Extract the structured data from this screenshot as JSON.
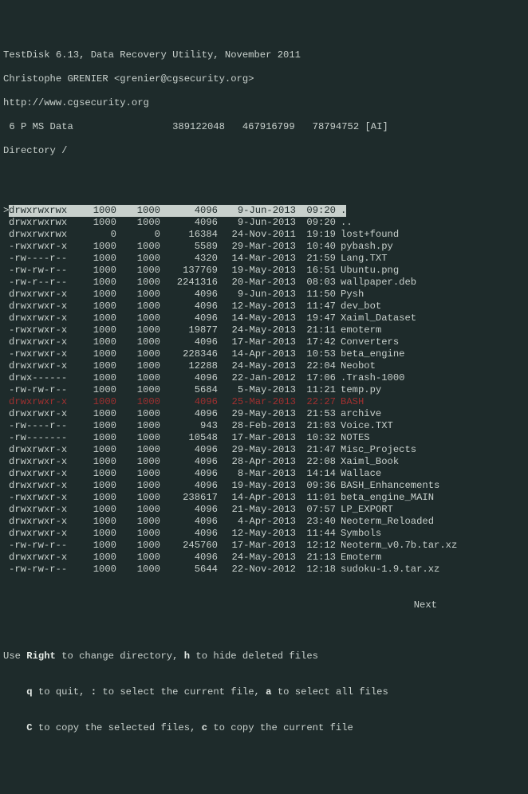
{
  "header": {
    "l1": "TestDisk 6.13, Data Recovery Utility, November 2011",
    "l2": "Christophe GRENIER <grenier@cgsecurity.org>",
    "l3": "http://www.cgsecurity.org",
    "part": " 6 P MS Data                 389122048   467916799   78794752 [AI]",
    "dir": "Directory /"
  },
  "entries": [
    {
      "sel": true,
      "red": false,
      "perms": "drwxrwxrwx",
      "uid": "1000",
      "gid": "1000",
      "size": "4096",
      "date": "9-Jun-2013",
      "time": "09:20",
      "name": "."
    },
    {
      "sel": false,
      "red": false,
      "perms": "drwxrwxrwx",
      "uid": "1000",
      "gid": "1000",
      "size": "4096",
      "date": "9-Jun-2013",
      "time": "09:20",
      "name": ".."
    },
    {
      "sel": false,
      "red": false,
      "perms": "drwxrwxrwx",
      "uid": "0",
      "gid": "0",
      "size": "16384",
      "date": "24-Nov-2011",
      "time": "19:19",
      "name": "lost+found"
    },
    {
      "sel": false,
      "red": false,
      "perms": "-rwxrwxr-x",
      "uid": "1000",
      "gid": "1000",
      "size": "5589",
      "date": "29-Mar-2013",
      "time": "10:40",
      "name": "pybash.py"
    },
    {
      "sel": false,
      "red": false,
      "perms": "-rw----r--",
      "uid": "1000",
      "gid": "1000",
      "size": "4320",
      "date": "14-Mar-2013",
      "time": "21:59",
      "name": "Lang.TXT"
    },
    {
      "sel": false,
      "red": false,
      "perms": "-rw-rw-r--",
      "uid": "1000",
      "gid": "1000",
      "size": "137769",
      "date": "19-May-2013",
      "time": "16:51",
      "name": "Ubuntu.png"
    },
    {
      "sel": false,
      "red": false,
      "perms": "-rw-r--r--",
      "uid": "1000",
      "gid": "1000",
      "size": "2241316",
      "date": "20-Mar-2013",
      "time": "08:03",
      "name": "wallpaper.deb"
    },
    {
      "sel": false,
      "red": false,
      "perms": "drwxrwxr-x",
      "uid": "1000",
      "gid": "1000",
      "size": "4096",
      "date": "9-Jun-2013",
      "time": "11:50",
      "name": "Pysh"
    },
    {
      "sel": false,
      "red": false,
      "perms": "drwxrwxr-x",
      "uid": "1000",
      "gid": "1000",
      "size": "4096",
      "date": "12-May-2013",
      "time": "11:47",
      "name": "dev_bot"
    },
    {
      "sel": false,
      "red": false,
      "perms": "drwxrwxr-x",
      "uid": "1000",
      "gid": "1000",
      "size": "4096",
      "date": "14-May-2013",
      "time": "19:47",
      "name": "Xaiml_Dataset"
    },
    {
      "sel": false,
      "red": false,
      "perms": "-rwxrwxr-x",
      "uid": "1000",
      "gid": "1000",
      "size": "19877",
      "date": "24-May-2013",
      "time": "21:11",
      "name": "emoterm"
    },
    {
      "sel": false,
      "red": false,
      "perms": "drwxrwxr-x",
      "uid": "1000",
      "gid": "1000",
      "size": "4096",
      "date": "17-Mar-2013",
      "time": "17:42",
      "name": "Converters"
    },
    {
      "sel": false,
      "red": false,
      "perms": "-rwxrwxr-x",
      "uid": "1000",
      "gid": "1000",
      "size": "228346",
      "date": "14-Apr-2013",
      "time": "10:53",
      "name": "beta_engine"
    },
    {
      "sel": false,
      "red": false,
      "perms": "drwxrwxr-x",
      "uid": "1000",
      "gid": "1000",
      "size": "12288",
      "date": "24-May-2013",
      "time": "22:04",
      "name": "Neobot"
    },
    {
      "sel": false,
      "red": false,
      "perms": "drwx------",
      "uid": "1000",
      "gid": "1000",
      "size": "4096",
      "date": "22-Jan-2012",
      "time": "17:06",
      "name": ".Trash-1000"
    },
    {
      "sel": false,
      "red": false,
      "perms": "-rw-rw-r--",
      "uid": "1000",
      "gid": "1000",
      "size": "5684",
      "date": "5-May-2013",
      "time": "11:21",
      "name": "temp.py"
    },
    {
      "sel": false,
      "red": true,
      "perms": "drwxrwxr-x",
      "uid": "1000",
      "gid": "1000",
      "size": "4096",
      "date": "25-Mar-2013",
      "time": "22:27",
      "name": "BASH"
    },
    {
      "sel": false,
      "red": false,
      "perms": "drwxrwxr-x",
      "uid": "1000",
      "gid": "1000",
      "size": "4096",
      "date": "29-May-2013",
      "time": "21:53",
      "name": "archive"
    },
    {
      "sel": false,
      "red": false,
      "perms": "-rw----r--",
      "uid": "1000",
      "gid": "1000",
      "size": "943",
      "date": "28-Feb-2013",
      "time": "21:03",
      "name": "Voice.TXT"
    },
    {
      "sel": false,
      "red": false,
      "perms": "-rw-------",
      "uid": "1000",
      "gid": "1000",
      "size": "10548",
      "date": "17-Mar-2013",
      "time": "10:32",
      "name": "NOTES"
    },
    {
      "sel": false,
      "red": false,
      "perms": "drwxrwxr-x",
      "uid": "1000",
      "gid": "1000",
      "size": "4096",
      "date": "29-May-2013",
      "time": "21:47",
      "name": "Misc_Projects"
    },
    {
      "sel": false,
      "red": false,
      "perms": "drwxrwxr-x",
      "uid": "1000",
      "gid": "1000",
      "size": "4096",
      "date": "28-Apr-2013",
      "time": "22:08",
      "name": "Xaiml_Book"
    },
    {
      "sel": false,
      "red": false,
      "perms": "drwxrwxr-x",
      "uid": "1000",
      "gid": "1000",
      "size": "4096",
      "date": "8-Mar-2013",
      "time": "14:14",
      "name": "Wallace"
    },
    {
      "sel": false,
      "red": false,
      "perms": "drwxrwxr-x",
      "uid": "1000",
      "gid": "1000",
      "size": "4096",
      "date": "19-May-2013",
      "time": "09:36",
      "name": "BASH_Enhancements"
    },
    {
      "sel": false,
      "red": false,
      "perms": "-rwxrwxr-x",
      "uid": "1000",
      "gid": "1000",
      "size": "238617",
      "date": "14-Apr-2013",
      "time": "11:01",
      "name": "beta_engine_MAIN"
    },
    {
      "sel": false,
      "red": false,
      "perms": "drwxrwxr-x",
      "uid": "1000",
      "gid": "1000",
      "size": "4096",
      "date": "21-May-2013",
      "time": "07:57",
      "name": "LP_EXPORT"
    },
    {
      "sel": false,
      "red": false,
      "perms": "drwxrwxr-x",
      "uid": "1000",
      "gid": "1000",
      "size": "4096",
      "date": "4-Apr-2013",
      "time": "23:40",
      "name": "Neoterm_Reloaded"
    },
    {
      "sel": false,
      "red": false,
      "perms": "drwxrwxr-x",
      "uid": "1000",
      "gid": "1000",
      "size": "4096",
      "date": "12-May-2013",
      "time": "11:44",
      "name": "Symbols"
    },
    {
      "sel": false,
      "red": false,
      "perms": "-rw-rw-r--",
      "uid": "1000",
      "gid": "1000",
      "size": "245760",
      "date": "17-Mar-2013",
      "time": "12:12",
      "name": "Neoterm_v0.7b.tar.xz"
    },
    {
      "sel": false,
      "red": false,
      "perms": "drwxrwxr-x",
      "uid": "1000",
      "gid": "1000",
      "size": "4096",
      "date": "24-May-2013",
      "time": "21:13",
      "name": "Emoterm"
    },
    {
      "sel": false,
      "red": false,
      "perms": "-rw-rw-r--",
      "uid": "1000",
      "gid": "1000",
      "size": "5644",
      "date": "22-Nov-2012",
      "time": "12:18",
      "name": "sudoku-1.9.tar.xz"
    }
  ],
  "next": "Next",
  "help": {
    "l1_pre": "Use ",
    "k_right": "Right",
    "l1_mid": " to change directory, ",
    "k_h": "h",
    "l1_end": " to hide deleted files",
    "l2_pre": "    ",
    "k_q": "q",
    "l2_a": " to quit, ",
    "k_colon": ":",
    "l2_b": " to select the current file, ",
    "k_a": "a",
    "l2_c": " to select all files",
    "l3_pre": "    ",
    "k_C": "C",
    "l3_a": " to copy the selected files, ",
    "k_c": "c",
    "l3_b": " to copy the current file"
  }
}
